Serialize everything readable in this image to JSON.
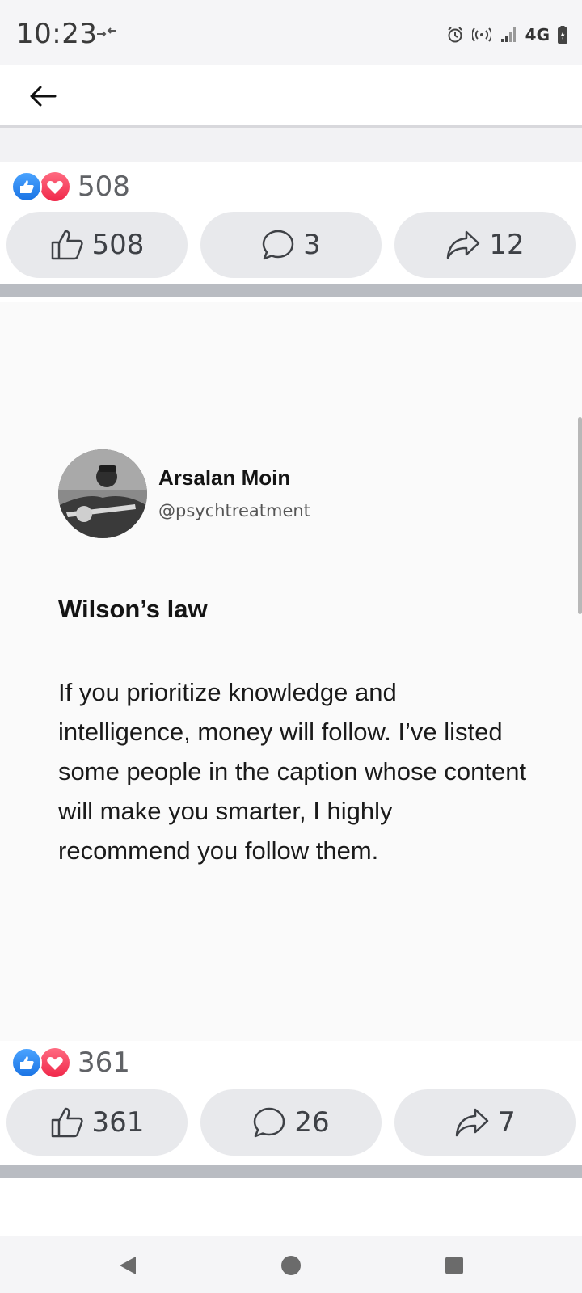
{
  "status_bar": {
    "time": "10:23",
    "network": "4G"
  },
  "top_bar": {
    "back_icon": "arrow-left-icon"
  },
  "post1": {
    "reaction_count": "508",
    "actions": {
      "like_count": "508",
      "comment_count": "3",
      "share_count": "12"
    }
  },
  "post2": {
    "author_name": "Arsalan Moin",
    "author_handle": "@psychtreatment",
    "title": "Wilson’s law",
    "body": "If you prioritize knowledge and intelligence, money will follow. I’ve listed some people in the caption whose content will make you smarter, I highly recommend you follow them.",
    "reaction_count": "361",
    "actions": {
      "like_count": "361",
      "comment_count": "26",
      "share_count": "7"
    }
  },
  "colors": {
    "like_blue": "#1b74e4",
    "love_red": "#f0284a",
    "button_bg": "#e8e9ec",
    "divider": "#b9bcc2"
  }
}
